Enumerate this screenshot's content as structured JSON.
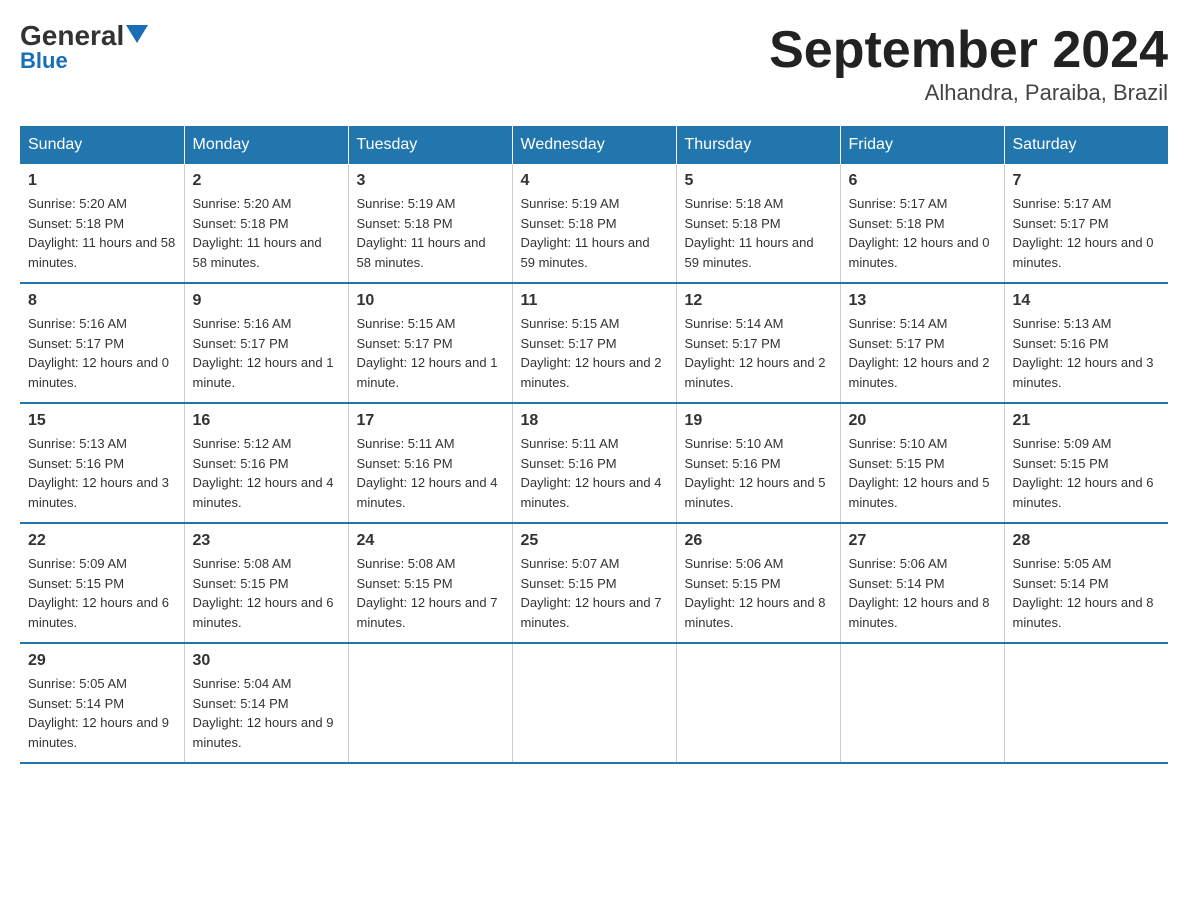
{
  "logo": {
    "text": "General",
    "blue": "Blue"
  },
  "title": "September 2024",
  "location": "Alhandra, Paraiba, Brazil",
  "headers": [
    "Sunday",
    "Monday",
    "Tuesday",
    "Wednesday",
    "Thursday",
    "Friday",
    "Saturday"
  ],
  "weeks": [
    [
      {
        "day": "1",
        "sunrise": "Sunrise: 5:20 AM",
        "sunset": "Sunset: 5:18 PM",
        "daylight": "Daylight: 11 hours and 58 minutes."
      },
      {
        "day": "2",
        "sunrise": "Sunrise: 5:20 AM",
        "sunset": "Sunset: 5:18 PM",
        "daylight": "Daylight: 11 hours and 58 minutes."
      },
      {
        "day": "3",
        "sunrise": "Sunrise: 5:19 AM",
        "sunset": "Sunset: 5:18 PM",
        "daylight": "Daylight: 11 hours and 58 minutes."
      },
      {
        "day": "4",
        "sunrise": "Sunrise: 5:19 AM",
        "sunset": "Sunset: 5:18 PM",
        "daylight": "Daylight: 11 hours and 59 minutes."
      },
      {
        "day": "5",
        "sunrise": "Sunrise: 5:18 AM",
        "sunset": "Sunset: 5:18 PM",
        "daylight": "Daylight: 11 hours and 59 minutes."
      },
      {
        "day": "6",
        "sunrise": "Sunrise: 5:17 AM",
        "sunset": "Sunset: 5:18 PM",
        "daylight": "Daylight: 12 hours and 0 minutes."
      },
      {
        "day": "7",
        "sunrise": "Sunrise: 5:17 AM",
        "sunset": "Sunset: 5:17 PM",
        "daylight": "Daylight: 12 hours and 0 minutes."
      }
    ],
    [
      {
        "day": "8",
        "sunrise": "Sunrise: 5:16 AM",
        "sunset": "Sunset: 5:17 PM",
        "daylight": "Daylight: 12 hours and 0 minutes."
      },
      {
        "day": "9",
        "sunrise": "Sunrise: 5:16 AM",
        "sunset": "Sunset: 5:17 PM",
        "daylight": "Daylight: 12 hours and 1 minute."
      },
      {
        "day": "10",
        "sunrise": "Sunrise: 5:15 AM",
        "sunset": "Sunset: 5:17 PM",
        "daylight": "Daylight: 12 hours and 1 minute."
      },
      {
        "day": "11",
        "sunrise": "Sunrise: 5:15 AM",
        "sunset": "Sunset: 5:17 PM",
        "daylight": "Daylight: 12 hours and 2 minutes."
      },
      {
        "day": "12",
        "sunrise": "Sunrise: 5:14 AM",
        "sunset": "Sunset: 5:17 PM",
        "daylight": "Daylight: 12 hours and 2 minutes."
      },
      {
        "day": "13",
        "sunrise": "Sunrise: 5:14 AM",
        "sunset": "Sunset: 5:17 PM",
        "daylight": "Daylight: 12 hours and 2 minutes."
      },
      {
        "day": "14",
        "sunrise": "Sunrise: 5:13 AM",
        "sunset": "Sunset: 5:16 PM",
        "daylight": "Daylight: 12 hours and 3 minutes."
      }
    ],
    [
      {
        "day": "15",
        "sunrise": "Sunrise: 5:13 AM",
        "sunset": "Sunset: 5:16 PM",
        "daylight": "Daylight: 12 hours and 3 minutes."
      },
      {
        "day": "16",
        "sunrise": "Sunrise: 5:12 AM",
        "sunset": "Sunset: 5:16 PM",
        "daylight": "Daylight: 12 hours and 4 minutes."
      },
      {
        "day": "17",
        "sunrise": "Sunrise: 5:11 AM",
        "sunset": "Sunset: 5:16 PM",
        "daylight": "Daylight: 12 hours and 4 minutes."
      },
      {
        "day": "18",
        "sunrise": "Sunrise: 5:11 AM",
        "sunset": "Sunset: 5:16 PM",
        "daylight": "Daylight: 12 hours and 4 minutes."
      },
      {
        "day": "19",
        "sunrise": "Sunrise: 5:10 AM",
        "sunset": "Sunset: 5:16 PM",
        "daylight": "Daylight: 12 hours and 5 minutes."
      },
      {
        "day": "20",
        "sunrise": "Sunrise: 5:10 AM",
        "sunset": "Sunset: 5:15 PM",
        "daylight": "Daylight: 12 hours and 5 minutes."
      },
      {
        "day": "21",
        "sunrise": "Sunrise: 5:09 AM",
        "sunset": "Sunset: 5:15 PM",
        "daylight": "Daylight: 12 hours and 6 minutes."
      }
    ],
    [
      {
        "day": "22",
        "sunrise": "Sunrise: 5:09 AM",
        "sunset": "Sunset: 5:15 PM",
        "daylight": "Daylight: 12 hours and 6 minutes."
      },
      {
        "day": "23",
        "sunrise": "Sunrise: 5:08 AM",
        "sunset": "Sunset: 5:15 PM",
        "daylight": "Daylight: 12 hours and 6 minutes."
      },
      {
        "day": "24",
        "sunrise": "Sunrise: 5:08 AM",
        "sunset": "Sunset: 5:15 PM",
        "daylight": "Daylight: 12 hours and 7 minutes."
      },
      {
        "day": "25",
        "sunrise": "Sunrise: 5:07 AM",
        "sunset": "Sunset: 5:15 PM",
        "daylight": "Daylight: 12 hours and 7 minutes."
      },
      {
        "day": "26",
        "sunrise": "Sunrise: 5:06 AM",
        "sunset": "Sunset: 5:15 PM",
        "daylight": "Daylight: 12 hours and 8 minutes."
      },
      {
        "day": "27",
        "sunrise": "Sunrise: 5:06 AM",
        "sunset": "Sunset: 5:14 PM",
        "daylight": "Daylight: 12 hours and 8 minutes."
      },
      {
        "day": "28",
        "sunrise": "Sunrise: 5:05 AM",
        "sunset": "Sunset: 5:14 PM",
        "daylight": "Daylight: 12 hours and 8 minutes."
      }
    ],
    [
      {
        "day": "29",
        "sunrise": "Sunrise: 5:05 AM",
        "sunset": "Sunset: 5:14 PM",
        "daylight": "Daylight: 12 hours and 9 minutes."
      },
      {
        "day": "30",
        "sunrise": "Sunrise: 5:04 AM",
        "sunset": "Sunset: 5:14 PM",
        "daylight": "Daylight: 12 hours and 9 minutes."
      },
      null,
      null,
      null,
      null,
      null
    ]
  ]
}
